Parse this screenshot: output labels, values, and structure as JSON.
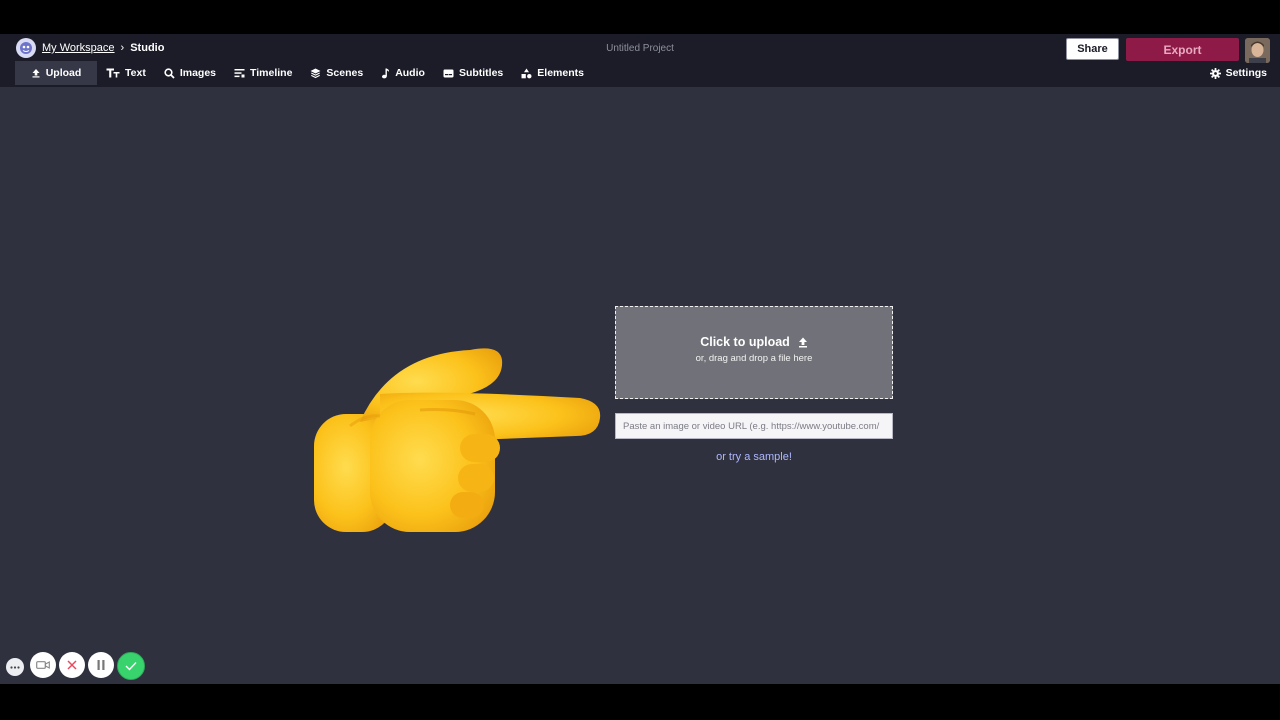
{
  "breadcrumb": {
    "workspace": "My Workspace",
    "separator": "›",
    "current": "Studio"
  },
  "project": {
    "title": "Untitled Project"
  },
  "header_actions": {
    "share_label": "Share",
    "export_label": "Export"
  },
  "tabs": [
    {
      "label": "Upload",
      "icon": "upload-icon",
      "active": true
    },
    {
      "label": "Text",
      "icon": "text-icon"
    },
    {
      "label": "Images",
      "icon": "search-icon"
    },
    {
      "label": "Timeline",
      "icon": "timeline-icon"
    },
    {
      "label": "Scenes",
      "icon": "layers-icon"
    },
    {
      "label": "Audio",
      "icon": "music-note-icon"
    },
    {
      "label": "Subtitles",
      "icon": "subtitles-icon"
    },
    {
      "label": "Elements",
      "icon": "shapes-icon"
    }
  ],
  "settings": {
    "label": "Settings",
    "icon": "gear-icon"
  },
  "upload": {
    "title": "Click to upload",
    "subtitle": "or, drag and drop a file here",
    "url_placeholder": "Paste an image or video URL (e.g. https://www.youtube.com/",
    "sample_link": "or try a sample!"
  },
  "recorder_controls": [
    {
      "icon": "more-icon"
    },
    {
      "icon": "camera-icon"
    },
    {
      "icon": "close-icon"
    },
    {
      "icon": "pause-icon"
    },
    {
      "icon": "check-icon"
    }
  ],
  "colors": {
    "canvas_bg": "#30313e",
    "topbar_bg": "#1b1c27",
    "export_bg": "#8e1b47",
    "link": "#aeb7ff",
    "confirm": "#39d36e"
  }
}
